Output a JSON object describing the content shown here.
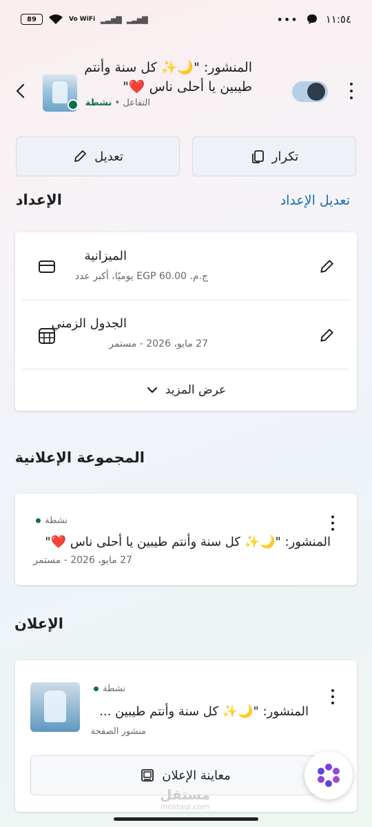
{
  "status_bar": {
    "battery": "89",
    "network": "Vo WiFi",
    "time": "١١:٥٤"
  },
  "header": {
    "post_title": "المنشور: \"🌙✨ كل سنة وأنتم طيبين يا أحلى ناس ❤️\"",
    "objective": "التفاعل",
    "separator": "•",
    "status": "نشطة"
  },
  "actions": {
    "edit_label": "تعديل",
    "repeat_label": "تكرار"
  },
  "setup": {
    "title": "الإعداد",
    "edit_link": "تعديل الإعداد",
    "budget": {
      "title": "الميزانية",
      "subtitle": "ج.م. EGP 60.00 يوميًا، أكبر عدد"
    },
    "schedule": {
      "title": "الجدول الزمني",
      "subtitle": "27 مايو، 2026 - مستمر"
    },
    "show_more": "عرض المزيد"
  },
  "ad_set": {
    "section_title": "المجموعة الإعلانية",
    "status": "نشطة",
    "title": "المنشور: \"🌙✨ كل سنة وأنتم طيبين يا أحلى ناس ❤️\"",
    "meta": "27 مايو، 2026 - مستمر"
  },
  "ad": {
    "section_title": "الإعلان",
    "status": "نشطة",
    "title": "المنشور: \"🌙✨ كل سنة وأنتم طيبين ...",
    "type": "منشور الصفحة",
    "preview_label": "معاينة الإعلان"
  },
  "watermark": {
    "arabic": "مستقل",
    "latin": "mostaql.com"
  },
  "colors": {
    "accent_link": "#1a6bb0",
    "active_green": "#0d6e4f",
    "toggle_track": "#b7cfe6",
    "toggle_knob": "#2e3d4a"
  }
}
